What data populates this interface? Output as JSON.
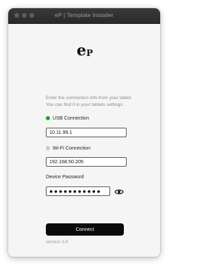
{
  "window": {
    "title": "eP | Template Installer"
  },
  "logo": {
    "main_letter": "e",
    "sub_letter": "P"
  },
  "intro": {
    "line1": "Enter the connection info from your tablet.",
    "line2": "You can find it in your tablets settings."
  },
  "usb": {
    "label": "USB Connection",
    "status_color": "#1aa52a",
    "value": "10.11.99.1"
  },
  "wifi": {
    "label": "Wi-Fi Connection",
    "status_color": "#c8c8c8",
    "value": "192.168.50.205"
  },
  "password": {
    "label": "Device Password",
    "masked_value": "●●●●●●●●●●●",
    "toggle_icon": "eye-icon"
  },
  "connect_button": {
    "label": "Connect"
  },
  "footer": {
    "version": "version 3.0"
  },
  "colors": {
    "titlebar": "#2e2e2e",
    "background": "#f5f5f5",
    "button": "#0b0b0b"
  }
}
